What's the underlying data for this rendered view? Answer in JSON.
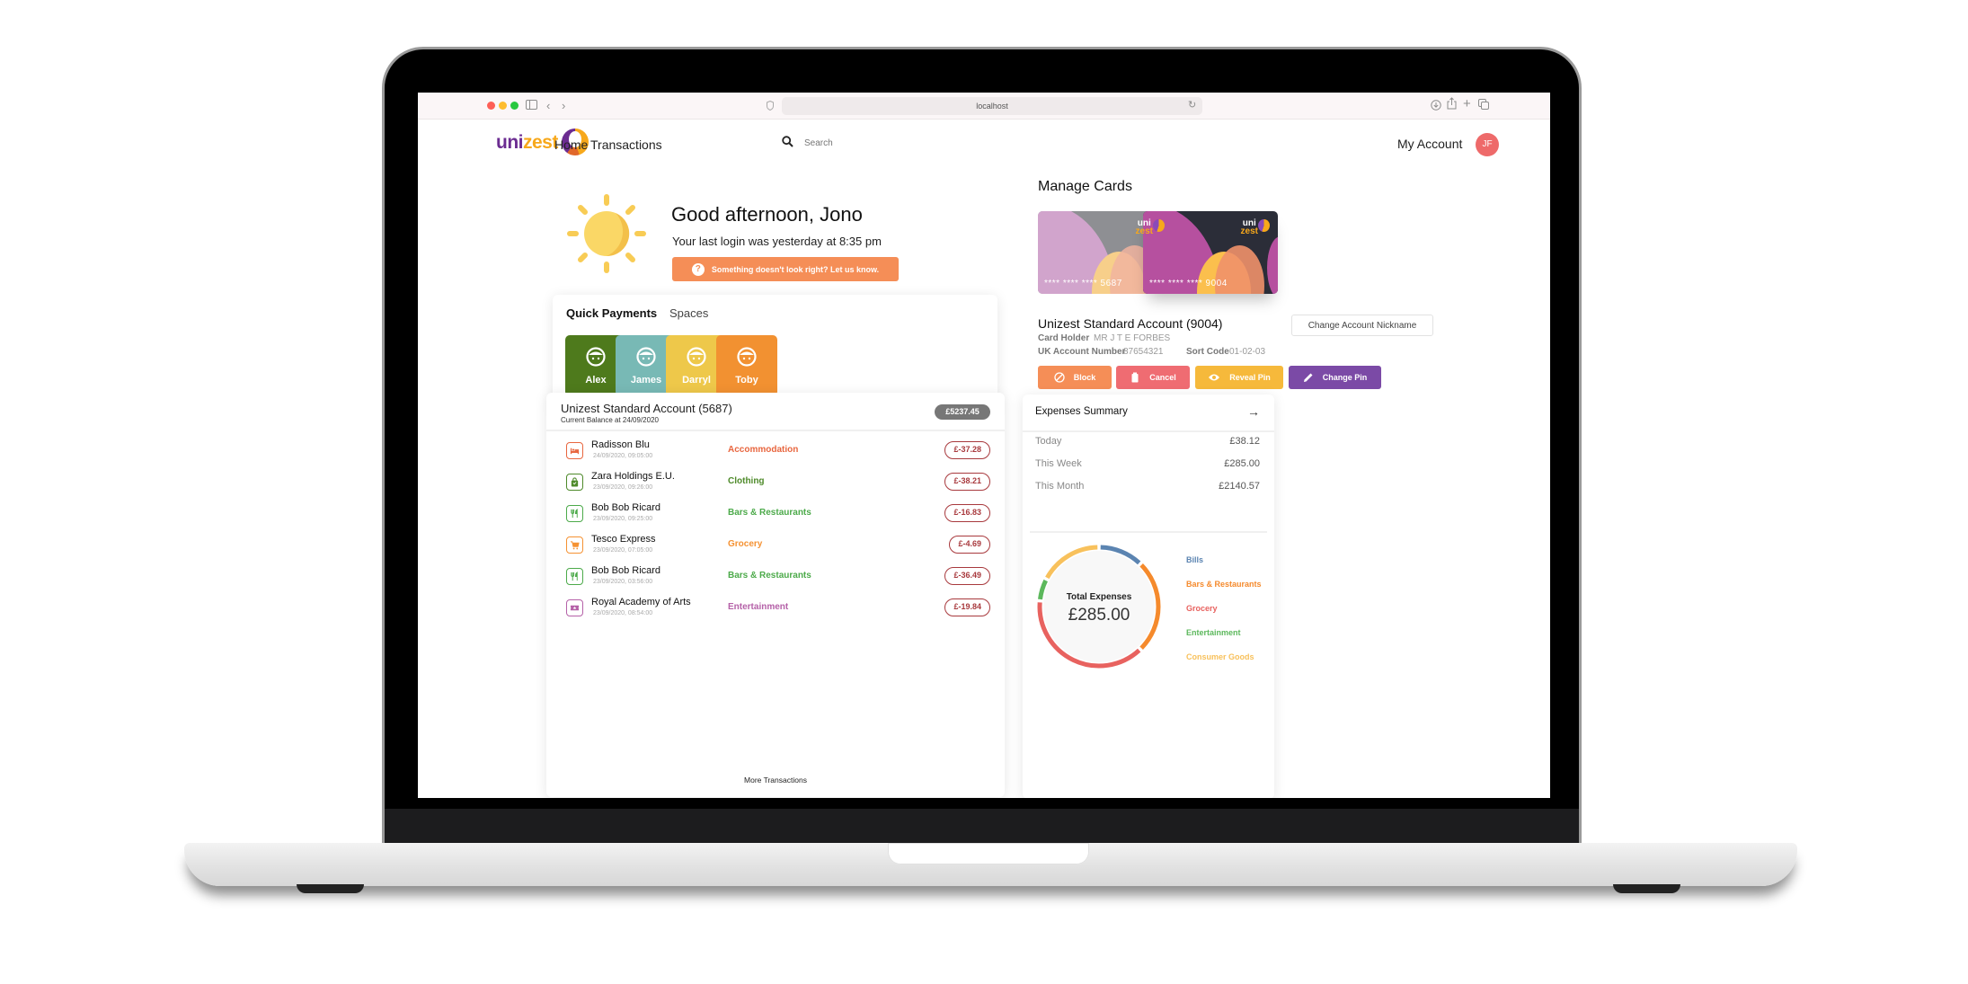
{
  "browser": {
    "url": "localhost",
    "traffic_lights": [
      "#fd5f57",
      "#febc2e",
      "#28c840"
    ]
  },
  "nav": {
    "logo_uni": "uni",
    "logo_zest": "zest",
    "links": [
      {
        "label": "Home"
      },
      {
        "label": "Transactions"
      }
    ],
    "search_placeholder": "Search",
    "my_account": "My Account",
    "avatar_initials": "JF"
  },
  "greeting": {
    "title": "Good afternoon, Jono",
    "last_login": "Your last login was yesterday at 8:35 pm",
    "feedback_button": "Something doesn't look right? Let us know.",
    "weather_icon": "sun-icon"
  },
  "quick_payments": {
    "tabs": [
      {
        "label": "Quick Payments",
        "active": true
      },
      {
        "label": "Spaces",
        "active": false
      }
    ],
    "payees": [
      {
        "name": "Alex",
        "color": "#4e7a1c"
      },
      {
        "name": "James",
        "color": "#78b9b5"
      },
      {
        "name": "Darryl",
        "color": "#eec84a"
      },
      {
        "name": "Toby",
        "color": "#f29131"
      }
    ]
  },
  "manage_cards": {
    "title": "Manage Cards",
    "cards": [
      {
        "number": "**** **** **** 5687",
        "logo_top": "uni",
        "logo_bottom": "zest",
        "theme": "grey",
        "selected": false
      },
      {
        "number": "**** **** **** 9004",
        "logo_top": "uni",
        "logo_bottom": "zest",
        "theme": "dark",
        "selected": true
      }
    ],
    "account_name": "Unizest Standard Account (9004)",
    "nickname_button": "Change Account Nickname",
    "card_holder_label": "Card Holder",
    "card_holder": "MR J T E FORBES",
    "account_number_label": "UK Account Number",
    "account_number": "87654321",
    "sort_code_label": "Sort Code",
    "sort_code": "01-02-03",
    "actions": [
      {
        "label": "Block",
        "icon": "block-icon",
        "color": "#f58e57"
      },
      {
        "label": "Cancel",
        "icon": "trash-icon",
        "color": "#ef6c72"
      },
      {
        "label": "Reveal Pin",
        "icon": "eye-icon",
        "color": "#f6b93b"
      },
      {
        "label": "Change Pin",
        "icon": "pencil-icon",
        "color": "#7b4aa6"
      }
    ]
  },
  "transactions": {
    "account_title": "Unizest Standard Account (5687)",
    "balance_subtitle": "Current Balance at 24/09/2020",
    "balance": "£5237.45",
    "rows": [
      {
        "merchant": "Radisson Blu",
        "date": "24/09/2020, 09:05:00",
        "category": "Accommodation",
        "amount": "£-37.28",
        "icon": "bed-icon",
        "color": "#e8663f"
      },
      {
        "merchant": "Zara Holdings E.U.",
        "date": "23/09/2020, 09:26:00",
        "category": "Clothing",
        "amount": "£-38.21",
        "icon": "shopping-bag-icon",
        "color": "#4e8a2a"
      },
      {
        "merchant": "Bob Bob Ricard",
        "date": "23/09/2020, 09:25:00",
        "category": "Bars & Restaurants",
        "amount": "£-16.83",
        "icon": "cutlery-icon",
        "color": "#4caa4a"
      },
      {
        "merchant": "Tesco Express",
        "date": "23/09/2020, 07:05:00",
        "category": "Grocery",
        "amount": "£-4.69",
        "icon": "cart-icon",
        "color": "#f59233"
      },
      {
        "merchant": "Bob Bob Ricard",
        "date": "23/09/2020, 03:56:00",
        "category": "Bars & Restaurants",
        "amount": "£-36.49",
        "icon": "cutlery-icon",
        "color": "#4caa4a"
      },
      {
        "merchant": "Royal Academy of Arts",
        "date": "23/09/2020, 08:54:00",
        "category": "Entertainment",
        "amount": "£-19.84",
        "icon": "ticket-icon",
        "color": "#b561a8"
      }
    ],
    "more_label": "More Transactions"
  },
  "expenses": {
    "title": "Expenses Summary",
    "rows": [
      {
        "label": "Today",
        "value": "£38.12"
      },
      {
        "label": "This Week",
        "value": "£285.00"
      },
      {
        "label": "This Month",
        "value": "£2140.57"
      }
    ],
    "total_label": "Total Expenses",
    "total_value": "£285.00"
  },
  "chart_data": {
    "type": "pie",
    "title": "Total Expenses",
    "subtitle": "£285.00",
    "legend_position": "right",
    "categories": [
      "Bills",
      "Bars & Restaurants",
      "Grocery",
      "Entertainment",
      "Consumer Goods"
    ],
    "values": [
      12,
      25,
      38,
      6,
      17
    ],
    "unit": "percent of total (estimated)",
    "colors": [
      "#5b84b1",
      "#f58a2c",
      "#e8625f",
      "#5cb85c",
      "#f8c15c"
    ]
  }
}
